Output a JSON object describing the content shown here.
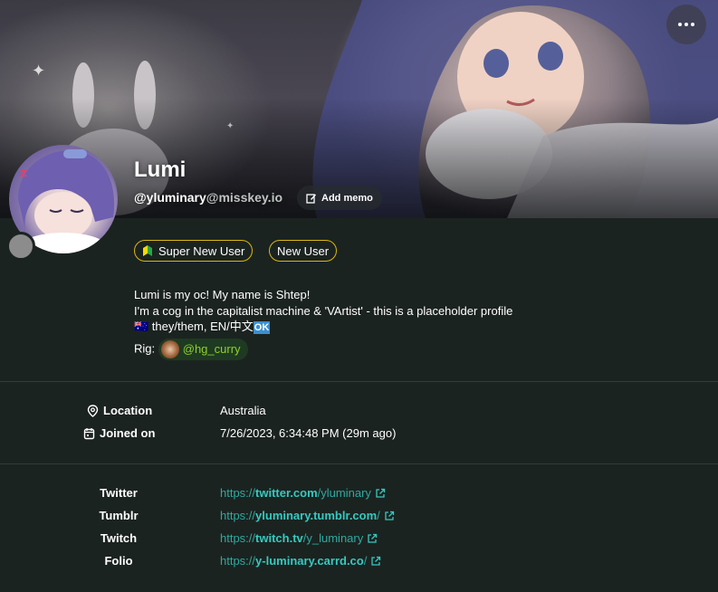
{
  "profile": {
    "name": "Lumi",
    "username": "@yluminary",
    "host": "@misskey.io",
    "add_memo_label": "Add memo"
  },
  "badges": [
    {
      "label": "Super New User",
      "icon": "beginner-leaf-icon"
    },
    {
      "label": "New User"
    }
  ],
  "bio": {
    "line1": "Lumi is my oc! My name is Shtep!",
    "line2": "I'm a cog in the capitalist machine & 'VArtist' - this is a placeholder profile",
    "line3_flag": "🇦🇺",
    "line3_text": " they/them, EN/中文",
    "line3_ok": "OK",
    "rig_label": "Rig:",
    "rig_mention": "@hg_curry"
  },
  "fields": [
    {
      "label": "Location",
      "icon": "location-pin-icon",
      "value": "Australia"
    },
    {
      "label": "Joined on",
      "icon": "calendar-icon",
      "value": "7/26/2023, 6:34:48 PM (29m ago)"
    }
  ],
  "links": [
    {
      "label": "Twitter",
      "prefix": "https://",
      "domain": "twitter.com",
      "path": "/yluminary"
    },
    {
      "label": "Tumblr",
      "prefix": "https://",
      "domain": "yluminary.tumblr.com",
      "path": "/"
    },
    {
      "label": "Twitch",
      "prefix": "https://",
      "domain": "twitch.tv",
      "path": "/y_luminary"
    },
    {
      "label": "Folio",
      "prefix": "https://",
      "domain": "y-luminary.carrd.co",
      "path": "/"
    }
  ],
  "colors": {
    "background": "#1b2320",
    "accent_link": "#36c9c0",
    "badge_border": "#d9b713",
    "mention": "#8fcf2f"
  }
}
